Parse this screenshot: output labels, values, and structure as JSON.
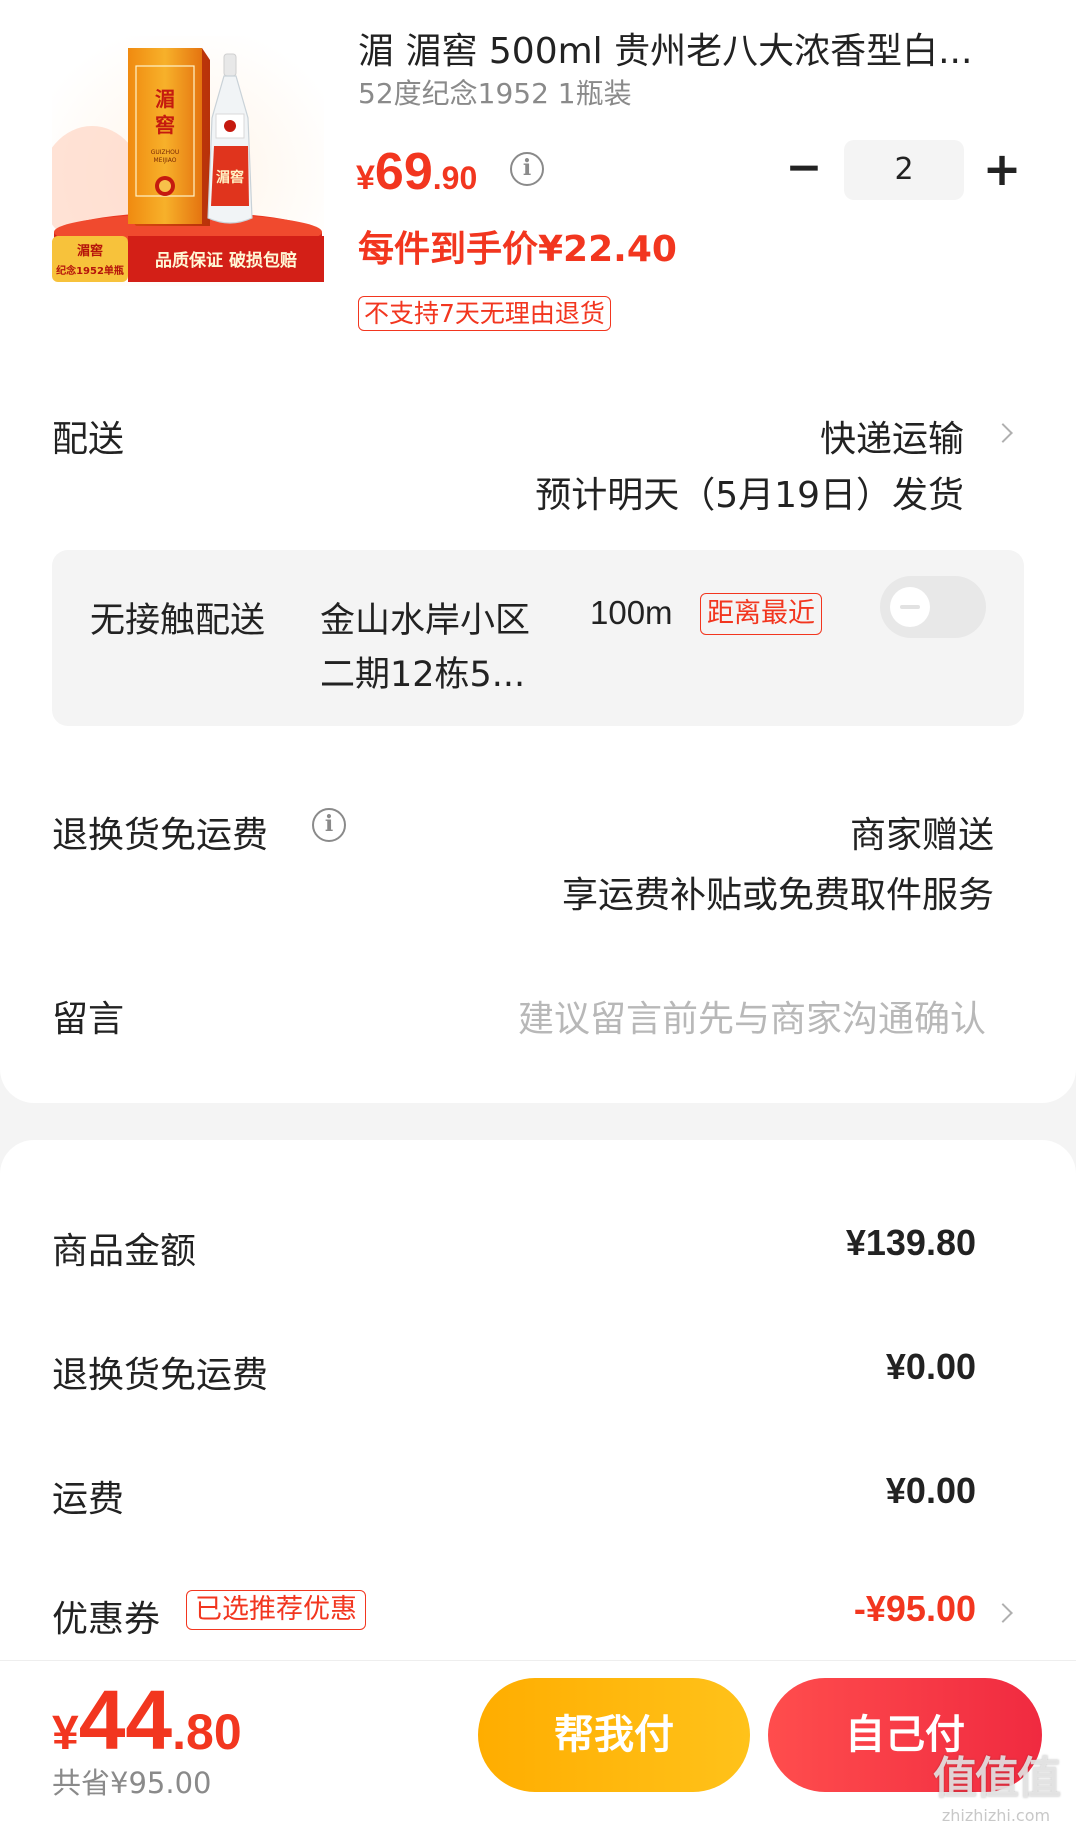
{
  "product": {
    "title": "湄 湄窖 500ml 贵州老八大浓香型白...",
    "spec": "52度纪念1952 1瓶装",
    "price_symbol": "¥",
    "price_int": "69",
    "price_dec": ".90",
    "quantity": "2",
    "minus_label": "−",
    "plus_label": "+",
    "unit_price_text": "每件到手价¥22.40",
    "no_return_tag": "不支持7天无理由退货",
    "image": {
      "brand": "湄窖",
      "brand_latin": "GUIZHOU MEIJIAO",
      "banner_left_top": "湄窖",
      "banner_left_bottom": "纪念1952单瓶",
      "banner_right": "品质保证 破损包赔"
    }
  },
  "delivery": {
    "label": "配送",
    "method": "快递运输",
    "estimate": "预计明天（5月19日）发货"
  },
  "contactless": {
    "label": "无接触配送",
    "address_line1": "金山水岸小区",
    "address_line2": "二期12栋5...",
    "distance": "100m",
    "nearest_tag": "距离最近"
  },
  "return_shipping": {
    "label": "退换货免运费",
    "value": "商家赠送",
    "subtitle": "享运费补贴或免费取件服务"
  },
  "message": {
    "label": "留言",
    "placeholder": "建议留言前先与商家沟通确认"
  },
  "summary": {
    "items": [
      {
        "label": "商品金额",
        "value": "¥139.80"
      },
      {
        "label": "退换货免运费",
        "value": "¥0.00"
      },
      {
        "label": "运费",
        "value": "¥0.00"
      }
    ],
    "coupon": {
      "label": "优惠券",
      "tag": "已选推荐优惠",
      "value": "-¥95.00"
    }
  },
  "footer": {
    "total_symbol": "¥",
    "total_int": "44",
    "total_dec": ".80",
    "saved": "共省¥95.00",
    "help_pay": "帮我付",
    "self_pay": "自己付"
  },
  "watermark": {
    "main": "值值值",
    "sub": "zhizhizhi.com"
  },
  "colors": {
    "accent_red": "#f2361f",
    "help_button": "#ffb300",
    "self_button": "#f5333f"
  }
}
